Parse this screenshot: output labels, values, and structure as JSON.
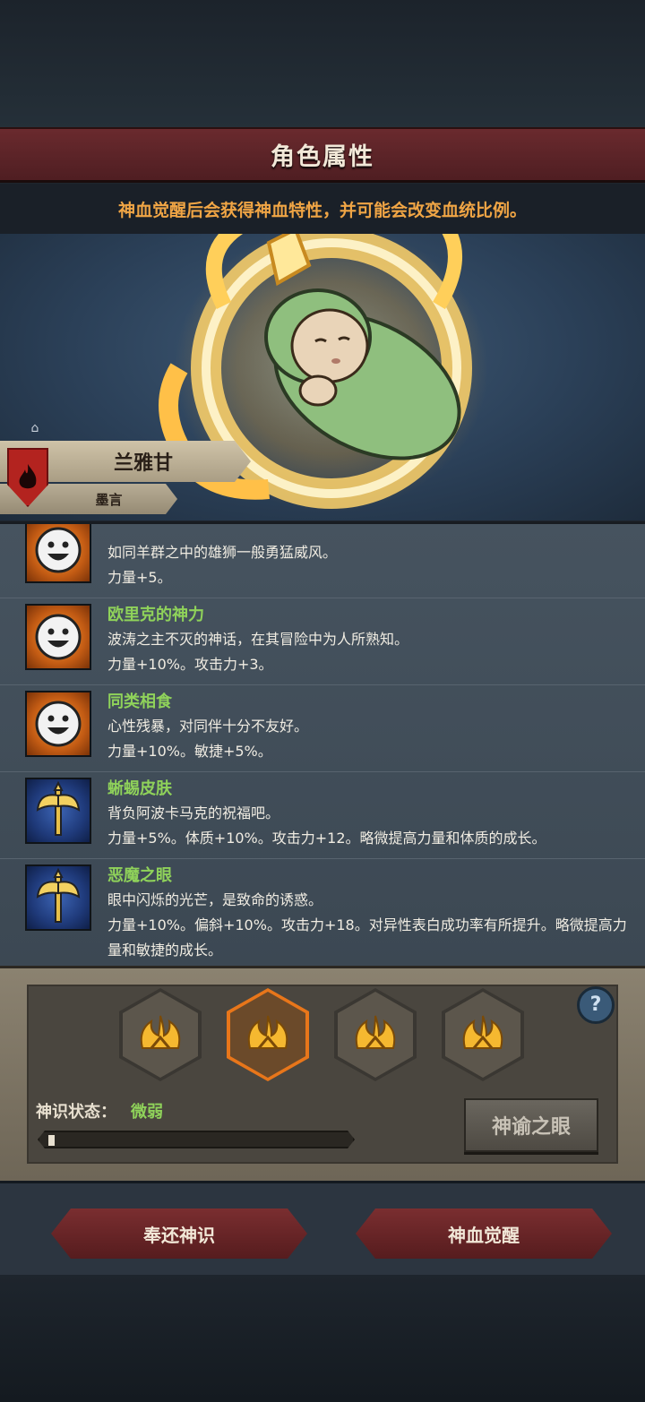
{
  "header": {
    "title": "角色属性",
    "notice": "神血觉醒后会获得神血特性，并可能会改变血统比例。"
  },
  "character": {
    "name": "兰雅甘",
    "subtitle": "墨言"
  },
  "traits": [
    {
      "icon": "smile-icon",
      "name": "",
      "desc": "如同羊群之中的雄狮一般勇猛威风。",
      "stats": "力量+5。"
    },
    {
      "icon": "smile-icon",
      "name": "欧里克的神力",
      "desc": "波涛之主不灭的神话，在其冒险中为人所熟知。",
      "stats": "力量+10%。攻击力+3。"
    },
    {
      "icon": "smile-icon",
      "name": "同类相食",
      "desc": "心性残暴，对同伴十分不友好。",
      "stats": "力量+10%。敏捷+5%。"
    },
    {
      "icon": "axe-icon",
      "name": "蜥蜴皮肤",
      "desc": "背负阿波卡马克的祝福吧。",
      "stats": "力量+5%。体质+10%。攻击力+12。略微提高力量和体质的成长。"
    },
    {
      "icon": "axe-icon",
      "name": "恶魔之眼",
      "desc": "眼中闪烁的光芒，是致命的诱惑。",
      "stats": "力量+10%。偏斜+10%。攻击力+18。对异性表白成功率有所提升。略微提高力量和敏捷的成长。"
    }
  ],
  "divine_panel": {
    "help": "?",
    "status_label": "神识状态：",
    "status_value": "微弱",
    "progress": 0.02,
    "oracle_button": "神谕之眼",
    "selected_slot": 1
  },
  "actions": {
    "return_label": "奉还神识",
    "awaken_label": "神血觉醒"
  },
  "colors": {
    "accent_orange": "#f0a545",
    "trait_green": "#8fd25a",
    "banner_red": "#6a2a2e"
  }
}
